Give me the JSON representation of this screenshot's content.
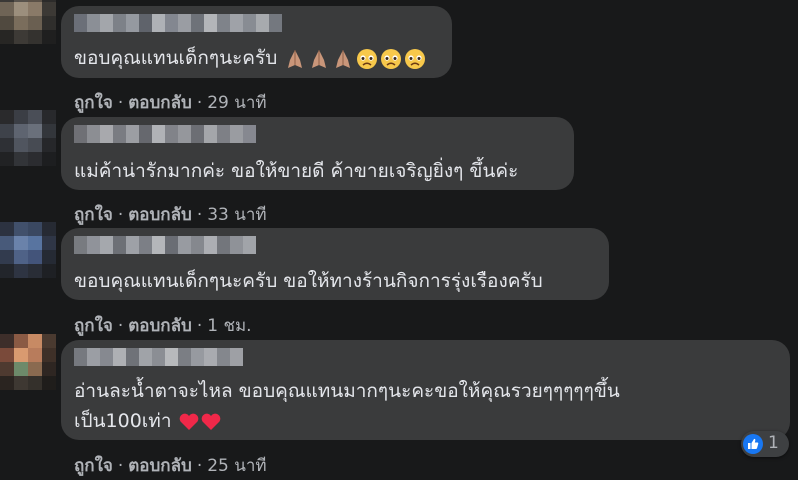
{
  "comments": [
    {
      "text": "ขอบคุณแทนเด็กๆนะครับ",
      "emojis": [
        "pray",
        "pray",
        "pray",
        "sad",
        "sad",
        "sad"
      ],
      "like_label": "ถูกใจ",
      "reply_label": "ตอบกลับ",
      "separator": "·",
      "time": "29 นาที"
    },
    {
      "text": "แม่ค้าน่ารักมากค่ะ ขอให้ขายดี ค้าขายเจริญยิ่งๆ ขึ้นค่ะ",
      "like_label": "ถูกใจ",
      "reply_label": "ตอบกลับ",
      "separator": "·",
      "time": "33 นาที"
    },
    {
      "text": "ขอบคุณแทนเด็กๆนะครับ ขอให้ทางร้านกิจการรุ่งเรืองครับ",
      "like_label": "ถูกใจ",
      "reply_label": "ตอบกลับ",
      "separator": "·",
      "time": "1 ชม."
    },
    {
      "text_line1": "อ่านละน้ำตาจะไหล ขอบคุณแทนมากๆนะคะขอให้คุณรวยๆๆๆๆๆขึ้น",
      "text_line2": "เป็น100เท่า",
      "emojis": [
        "heart",
        "heart"
      ],
      "like_label": "ถูกใจ",
      "reply_label": "ตอบกลับ",
      "separator": "·",
      "time": "25 นาที",
      "reaction": {
        "icon": "like-icon",
        "count": "1"
      }
    }
  ],
  "colors": {
    "background": "#18191a",
    "bubble": "#3a3b3c",
    "text": "#e4e6eb",
    "secondary_text": "#b0b3b8",
    "like_blue": "#1877f2",
    "heart_red": "#f02849"
  }
}
